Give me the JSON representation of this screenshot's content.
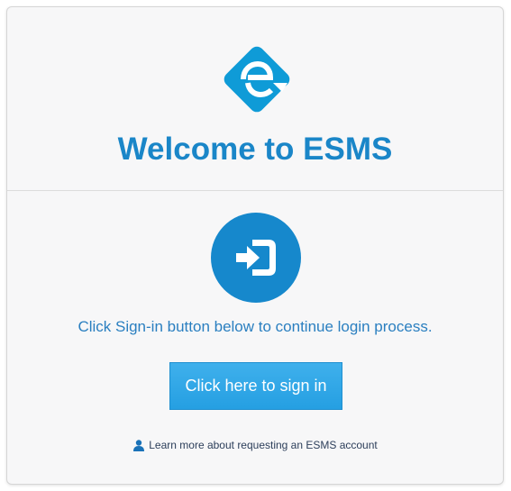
{
  "header": {
    "logo_icon": "esms-logo-icon",
    "title": "Welcome to ESMS"
  },
  "main": {
    "signin_icon": "sign-in-icon",
    "instruction": "Click Sign-in button below to continue login process.",
    "signin_button_label": "Click here to sign in",
    "learn_more_icon": "user-icon",
    "learn_more_label": "Learn more about requesting an ESMS account"
  },
  "colors": {
    "brand_blue": "#1a86c8",
    "button_blue": "#259fe2",
    "card_background": "#f7f7f8"
  }
}
